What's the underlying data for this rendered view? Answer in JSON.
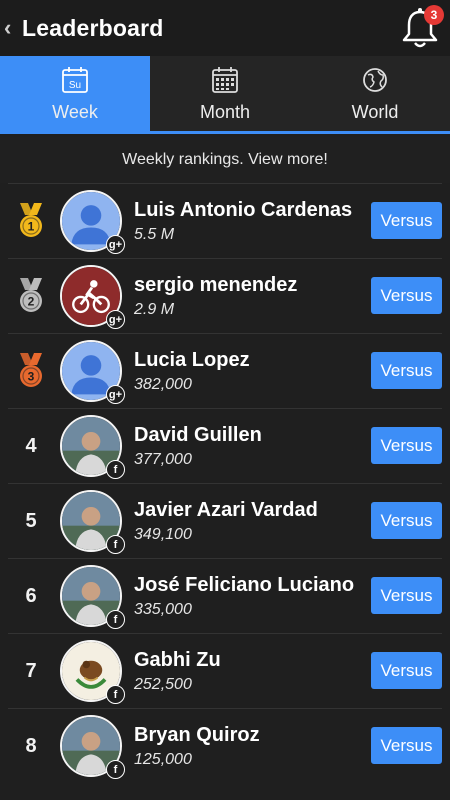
{
  "header": {
    "title": "Leaderboard",
    "back_glyph": "‹",
    "notification_count": "3"
  },
  "tabs": [
    {
      "label": "Week",
      "icon": "calendar-week-icon",
      "icon_text": "Su",
      "active": true
    },
    {
      "label": "Month",
      "icon": "calendar-month-icon",
      "active": false
    },
    {
      "label": "World",
      "icon": "globe-icon",
      "active": false
    }
  ],
  "subtitle": "Weekly rankings. View more!",
  "versus_label": "Versus",
  "colors": {
    "accent": "#3d8ef7",
    "gold": "#f2b81b",
    "silver": "#bdbdbd",
    "bronze": "#e8692e",
    "background": "#1f1f1f"
  },
  "players": [
    {
      "rank": "1",
      "name": "Luis Antonio Cardenas",
      "score": "5.5 M",
      "social": "g+",
      "avatar": "default"
    },
    {
      "rank": "2",
      "name": "sergio menendez",
      "score": "2.9 M",
      "social": "g+",
      "avatar": "cyclist"
    },
    {
      "rank": "3",
      "name": "Lucia Lopez",
      "score": "382,000",
      "social": "g+",
      "avatar": "default"
    },
    {
      "rank": "4",
      "name": "David Guillen",
      "score": "377,000",
      "social": "f",
      "avatar": "photo"
    },
    {
      "rank": "5",
      "name": "Javier Azari Vardad",
      "score": "349,100",
      "social": "f",
      "avatar": "photo"
    },
    {
      "rank": "6",
      "name": "José Feliciano Luciano",
      "score": "335,000",
      "social": "f",
      "avatar": "photo"
    },
    {
      "rank": "7",
      "name": "Gabhi Zu",
      "score": "252,500",
      "social": "f",
      "avatar": "emblem"
    },
    {
      "rank": "8",
      "name": "Bryan Quiroz",
      "score": "125,000",
      "social": "f",
      "avatar": "photo"
    }
  ]
}
